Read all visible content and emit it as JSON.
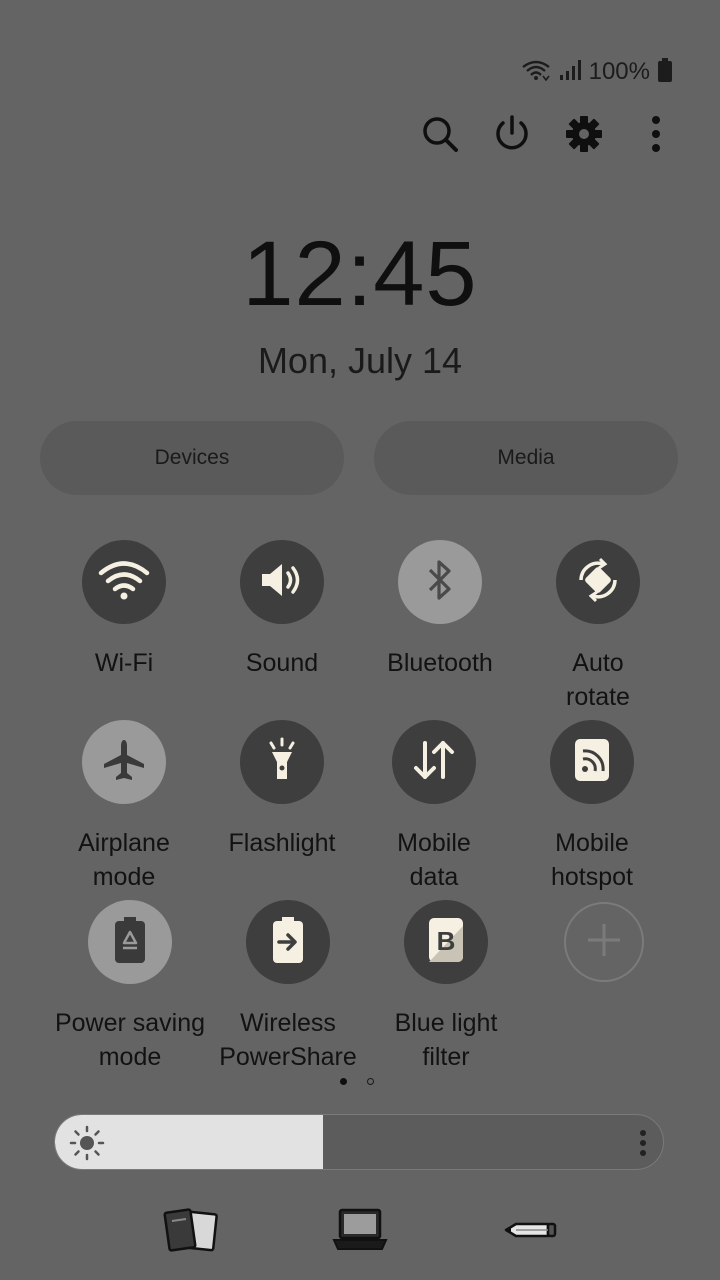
{
  "status_bar": {
    "battery_pct": "100%"
  },
  "clock": {
    "time": "12:45",
    "date": "Mon, July 14"
  },
  "panel_buttons": {
    "devices": "Devices",
    "media": "Media"
  },
  "tiles": {
    "wifi": {
      "label": "Wi-Fi",
      "state": "on"
    },
    "sound": {
      "label": "Sound",
      "state": "on"
    },
    "bluetooth": {
      "label": "Bluetooth",
      "state": "off"
    },
    "auto_rotate": {
      "label1": "Auto",
      "label2": "rotate",
      "state": "on"
    },
    "airplane": {
      "label1": "Airplane",
      "label2": "mode",
      "state": "off"
    },
    "flashlight": {
      "label": "Flashlight",
      "state": "on"
    },
    "mobile_data": {
      "label1": "Mobile",
      "label2": "data",
      "state": "on"
    },
    "hotspot": {
      "label1": "Mobile",
      "label2": "hotspot",
      "state": "on"
    },
    "power_saving": {
      "label1": "Power saving",
      "label2": "mode",
      "state": "off"
    },
    "wireless_powershare": {
      "label1": "Wireless",
      "label2": "PowerShare",
      "state": "on"
    },
    "blue_light": {
      "label1": "Blue light",
      "label2": "filter",
      "state": "on"
    }
  },
  "page_indicator": {
    "current": 1,
    "total": 2
  },
  "brightness": {
    "level_percent": 44
  },
  "colors": {
    "background": "#646464",
    "tile_on": "#3e3e3e",
    "tile_off": "#9a9a9a",
    "icon_light": "#f5f0e1"
  }
}
